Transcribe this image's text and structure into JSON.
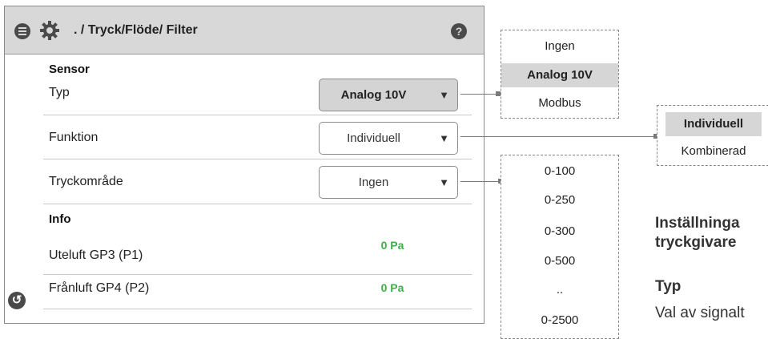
{
  "header": {
    "title": ". / Tryck/Flöde/ Filter",
    "help_glyph": "?",
    "icons": [
      "menu-icon",
      "gear-icon",
      "help-icon"
    ]
  },
  "sensor": {
    "heading": "Sensor",
    "rows": [
      {
        "label": "Typ",
        "value": "Analog 10V"
      },
      {
        "label": "Funktion",
        "value": "Individuell"
      },
      {
        "label": "Tryckområde",
        "value": "Ingen"
      }
    ],
    "dropdown_arrow": "▼"
  },
  "info": {
    "heading": "Info",
    "rows": [
      {
        "label": "Uteluft GP3 (P1)",
        "value": "0 Pa"
      },
      {
        "label": "Frånluft GP4 (P2)",
        "value": "0 Pa"
      }
    ],
    "value_color": "#3fae49"
  },
  "back_icon": "back-icon",
  "callouts": {
    "typ_options": [
      "Ingen",
      "Analog 10V",
      "Modbus"
    ],
    "typ_selected": "Analog 10V",
    "funktion_options": [
      "Individuell",
      "Kombinerad"
    ],
    "funktion_selected": "Individuell",
    "range_options": [
      "0-100",
      "0-250",
      "0-300",
      "0-500",
      "..",
      "0-2500"
    ]
  },
  "side_text": {
    "heading_line1": "Inställninga",
    "heading_line2": "tryckgivare",
    "subheading": "Typ",
    "body": "Val av signalt"
  }
}
